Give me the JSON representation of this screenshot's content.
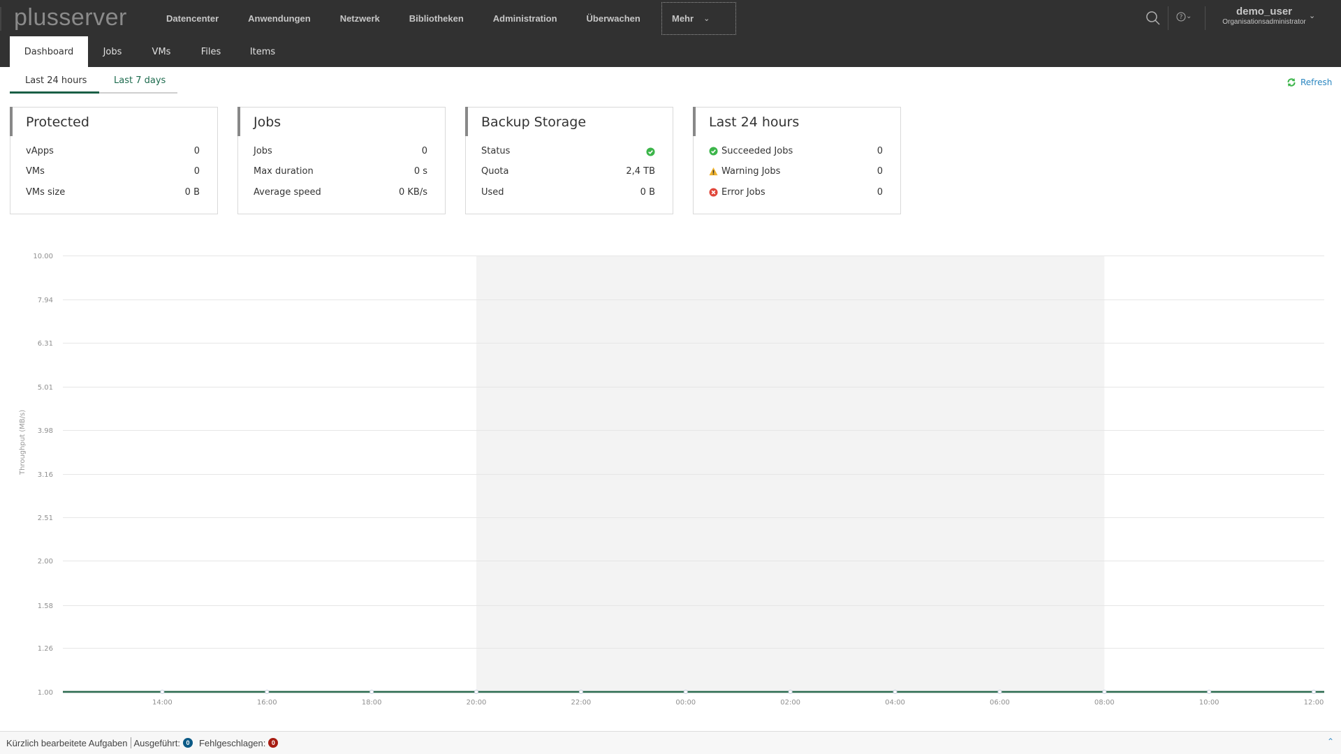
{
  "header": {
    "logo": "plusserver",
    "nav": [
      "Datencenter",
      "Anwendungen",
      "Netzwerk",
      "Bibliotheken",
      "Administration",
      "Überwachen"
    ],
    "more_label": "Mehr",
    "search_icon": "search-icon",
    "help_icon": "help-icon",
    "user": {
      "name": "demo_user",
      "role": "Organisationsadministrator"
    }
  },
  "subnav": {
    "tabs": [
      "Dashboard",
      "Jobs",
      "VMs",
      "Files",
      "Items"
    ],
    "active": "Dashboard"
  },
  "period": {
    "tabs": [
      "Last 24 hours",
      "Last 7 days"
    ],
    "active": "Last 24 hours",
    "refresh_label": "Refresh"
  },
  "cards": {
    "protected": {
      "title": "Protected",
      "rows": [
        {
          "label": "vApps",
          "value": "0"
        },
        {
          "label": "VMs",
          "value": "0"
        },
        {
          "label": "VMs size",
          "value": "0 B"
        }
      ]
    },
    "jobs": {
      "title": "Jobs",
      "rows": [
        {
          "label": "Jobs",
          "value": "0"
        },
        {
          "label": "Max duration",
          "value": "0 s"
        },
        {
          "label": "Average speed",
          "value": "0 KB/s"
        }
      ]
    },
    "storage": {
      "title": "Backup Storage",
      "rows": [
        {
          "label": "Status",
          "value": "ok",
          "icon": "check-circle-icon"
        },
        {
          "label": "Quota",
          "value": "2,4 TB"
        },
        {
          "label": "Used",
          "value": "0 B"
        }
      ]
    },
    "last24": {
      "title": "Last 24 hours",
      "rows": [
        {
          "label": "Succeeded Jobs",
          "value": "0",
          "icon": "check-circle-icon"
        },
        {
          "label": "Warning Jobs",
          "value": "0",
          "icon": "warning-icon"
        },
        {
          "label": "Error Jobs",
          "value": "0",
          "icon": "error-circle-icon"
        }
      ]
    }
  },
  "colors": {
    "header_bg": "#313131",
    "accent_green": "#1a5f46",
    "link_blue": "#2a86c0",
    "success": "#3cb54a",
    "warning": "#f0b32e",
    "error": "#e0463a",
    "badge_done": "#0b5a86",
    "badge_failed": "#a71d12",
    "night_band": "#f3f3f3"
  },
  "chart_data": {
    "type": "line",
    "title": "",
    "xlabel": "",
    "ylabel": "Throughput (MB/s)",
    "y_scale": "log",
    "ylim": [
      1.0,
      10.0
    ],
    "y_ticks": [
      "10.00",
      "7.94",
      "6.31",
      "5.01",
      "3.98",
      "3.16",
      "2.51",
      "2.00",
      "1.58",
      "1.26",
      "1.00"
    ],
    "x_ticks": [
      "14:00",
      "16:00",
      "18:00",
      "20:00",
      "22:00",
      "00:00",
      "02:00",
      "04:00",
      "06:00",
      "08:00",
      "10:00",
      "12:00"
    ],
    "x_hours": [
      14,
      16,
      18,
      20,
      22,
      24,
      26,
      28,
      30,
      32,
      34,
      36
    ],
    "xlim_hours": [
      12.1,
      36.2
    ],
    "shaded_band_hours": [
      20,
      32
    ],
    "grid": true,
    "series": [
      {
        "name": "Throughput",
        "x_hours": [
          12.1,
          14,
          16,
          18,
          20,
          22,
          24,
          26,
          28,
          30,
          32,
          34,
          36,
          36.2
        ],
        "values": [
          1.0,
          1.0,
          1.0,
          1.0,
          1.0,
          1.0,
          1.0,
          1.0,
          1.0,
          1.0,
          1.0,
          1.0,
          1.0,
          1.0
        ],
        "color": "#2e6e52"
      }
    ]
  },
  "statusbar": {
    "recent_tasks": "Kürzlich bearbeitete Aufgaben",
    "executed_label": "Ausgeführt:",
    "executed_count": "0",
    "failed_label": "Fehlgeschlagen:",
    "failed_count": "0"
  }
}
